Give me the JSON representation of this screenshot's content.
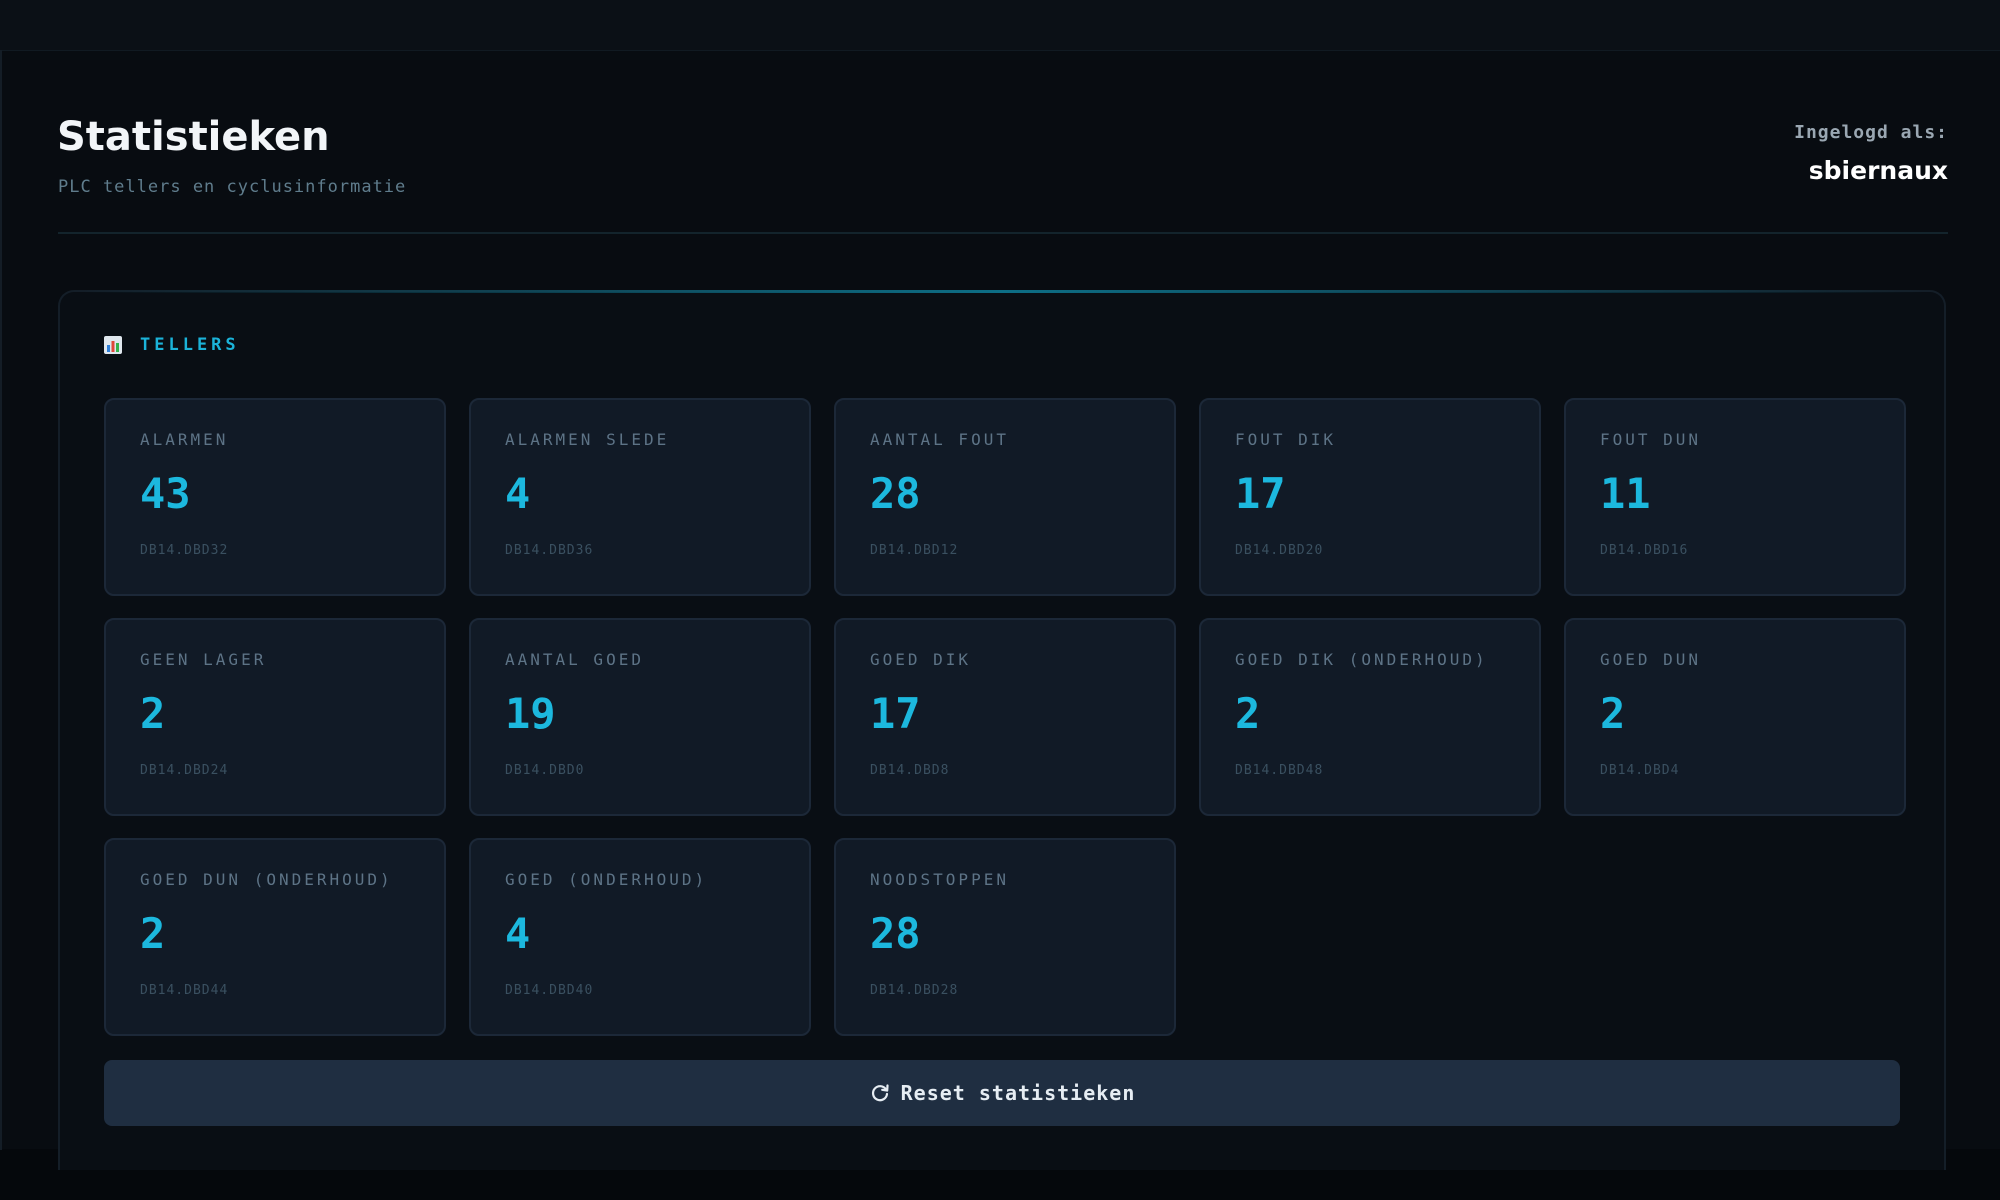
{
  "header": {
    "title": "Statistieken",
    "subtitle": "PLC tellers en cyclusinformatie",
    "login_label": "Ingelogd als:",
    "username": "sbiernaux"
  },
  "panel": {
    "icon": "bar-chart-icon",
    "title": "TELLERS"
  },
  "stats": [
    {
      "label": "ALARMEN",
      "value": "43",
      "address": "DB14.DBD32"
    },
    {
      "label": "ALARMEN SLEDE",
      "value": "4",
      "address": "DB14.DBD36"
    },
    {
      "label": "AANTAL FOUT",
      "value": "28",
      "address": "DB14.DBD12"
    },
    {
      "label": "FOUT DIK",
      "value": "17",
      "address": "DB14.DBD20"
    },
    {
      "label": "FOUT DUN",
      "value": "11",
      "address": "DB14.DBD16"
    },
    {
      "label": "GEEN LAGER",
      "value": "2",
      "address": "DB14.DBD24"
    },
    {
      "label": "AANTAL GOED",
      "value": "19",
      "address": "DB14.DBD0"
    },
    {
      "label": "GOED DIK",
      "value": "17",
      "address": "DB14.DBD8"
    },
    {
      "label": "GOED DIK (ONDERHOUD)",
      "value": "2",
      "address": "DB14.DBD48"
    },
    {
      "label": "GOED DUN",
      "value": "2",
      "address": "DB14.DBD4"
    },
    {
      "label": "GOED DUN (ONDERHOUD)",
      "value": "2",
      "address": "DB14.DBD44"
    },
    {
      "label": "GOED (ONDERHOUD)",
      "value": "4",
      "address": "DB14.DBD40"
    },
    {
      "label": "NOODSTOPPEN",
      "value": "28",
      "address": "DB14.DBD28"
    }
  ],
  "reset_button": {
    "icon": "refresh-icon",
    "label": "Reset statistieken"
  },
  "colors": {
    "accent": "#1cb8de",
    "card_background": "#111a26",
    "button_background": "#1f2e41",
    "page_background": "#080c11"
  }
}
